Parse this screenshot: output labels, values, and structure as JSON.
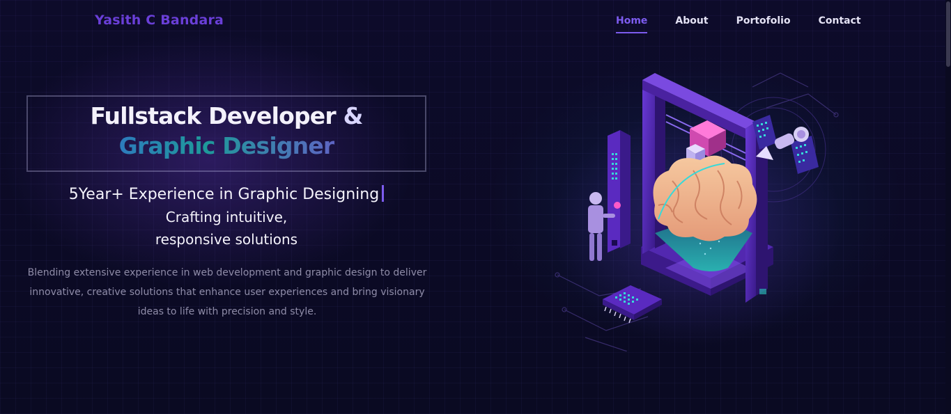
{
  "brand": {
    "name": "Yasith C Bandara"
  },
  "nav": {
    "items": [
      {
        "label": "Home",
        "active": true
      },
      {
        "label": "About",
        "active": false
      },
      {
        "label": "Portofolio",
        "active": false
      },
      {
        "label": "Contact",
        "active": false
      }
    ]
  },
  "hero": {
    "title_line1": "Fullstack Developer",
    "title_amp": "&",
    "title_line2": "Graphic Designer",
    "typed_text": "5Year+ Experience in Graphic Designing",
    "tagline_line1": "Crafting intuitive,",
    "tagline_line2": "responsive solutions",
    "description": "Blending extensive experience in web development and graphic design to deliver innovative, creative solutions that enhance user experiences and bring visionary ideas to life with precision and style."
  },
  "colors": {
    "background": "#0b0a24",
    "brand": "#6a3fd8",
    "accent": "#7d5cf0",
    "nav_text": "#e4e2f4",
    "description_text": "#8f8ca8"
  },
  "illustration": {
    "icon": "brain-3d-printer-robot-illustration"
  }
}
